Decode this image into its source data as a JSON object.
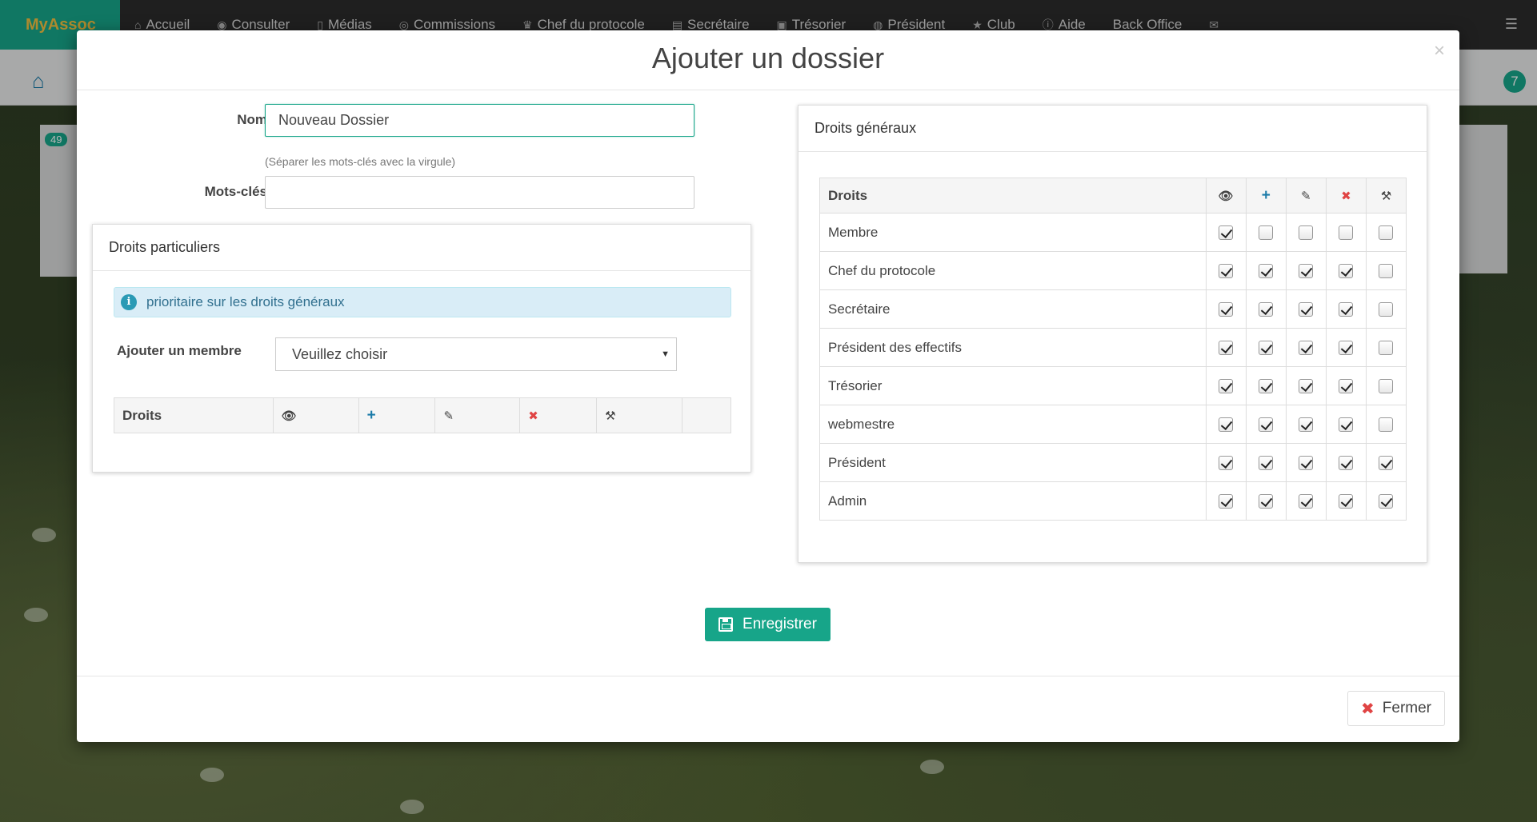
{
  "navbar": {
    "brand": "MyAssoc",
    "items": [
      {
        "label": "Accueil",
        "icon": "home-icon",
        "glyph": "⌂"
      },
      {
        "label": "Consulter",
        "icon": "eye-icon",
        "glyph": "◉"
      },
      {
        "label": "Médias",
        "icon": "file-icon",
        "glyph": "▯"
      },
      {
        "label": "Commissions",
        "icon": "user-circle-icon",
        "glyph": "◎"
      },
      {
        "label": "Chef du protocole",
        "icon": "trophy-icon",
        "glyph": "♛"
      },
      {
        "label": "Secrétaire",
        "icon": "book-icon",
        "glyph": "▤"
      },
      {
        "label": "Trésorier",
        "icon": "money-icon",
        "glyph": "▣"
      },
      {
        "label": "Président",
        "icon": "globe-icon",
        "glyph": "◍"
      },
      {
        "label": "Club",
        "icon": "star-icon",
        "glyph": "★"
      },
      {
        "label": "Aide",
        "icon": "info-circle-icon",
        "glyph": "ⓘ"
      },
      {
        "label": "Back Office",
        "icon": "",
        "glyph": ""
      },
      {
        "label": "",
        "icon": "envelope-icon",
        "glyph": "✉"
      }
    ]
  },
  "background": {
    "badge_count": "7",
    "panel_badge": "49"
  },
  "modal": {
    "title": "Ajouter un dossier",
    "close_glyph": "×",
    "form": {
      "nom_label": "Nom",
      "nom_value": "Nouveau Dossier",
      "keywords_help": "(Séparer les mots-clés avec la virgule)",
      "keywords_label": "Mots-clés",
      "keywords_value": ""
    },
    "particular_rights": {
      "title": "Droits particuliers",
      "info": "prioritaire sur les droits généraux",
      "add_member_label": "Ajouter un membre",
      "add_member_selected": "Veuillez choisir",
      "table_header": "Droits"
    },
    "general_rights": {
      "title": "Droits généraux",
      "table_header": "Droits",
      "columns": [
        {
          "icon": "eye-icon",
          "glyph": "👁"
        },
        {
          "icon": "plus-icon",
          "glyph": "+"
        },
        {
          "icon": "edit-icon",
          "glyph": "✎"
        },
        {
          "icon": "remove-icon",
          "glyph": "✖"
        },
        {
          "icon": "gavel-icon",
          "glyph": "⚒"
        }
      ],
      "rows": [
        {
          "role": "Membre",
          "rights": [
            true,
            false,
            false,
            false,
            false
          ]
        },
        {
          "role": "Chef du protocole",
          "rights": [
            true,
            true,
            true,
            true,
            false
          ]
        },
        {
          "role": "Secrétaire",
          "rights": [
            true,
            true,
            true,
            true,
            false
          ]
        },
        {
          "role": "Président des effectifs",
          "rights": [
            true,
            true,
            true,
            true,
            false
          ]
        },
        {
          "role": "Trésorier",
          "rights": [
            true,
            true,
            true,
            true,
            false
          ]
        },
        {
          "role": "webmestre",
          "rights": [
            true,
            true,
            true,
            true,
            false
          ]
        },
        {
          "role": "Président",
          "rights": [
            true,
            true,
            true,
            true,
            true
          ]
        },
        {
          "role": "Admin",
          "rights": [
            true,
            true,
            true,
            true,
            true
          ]
        }
      ]
    },
    "save_button": "Enregistrer",
    "close_button": "Fermer"
  }
}
